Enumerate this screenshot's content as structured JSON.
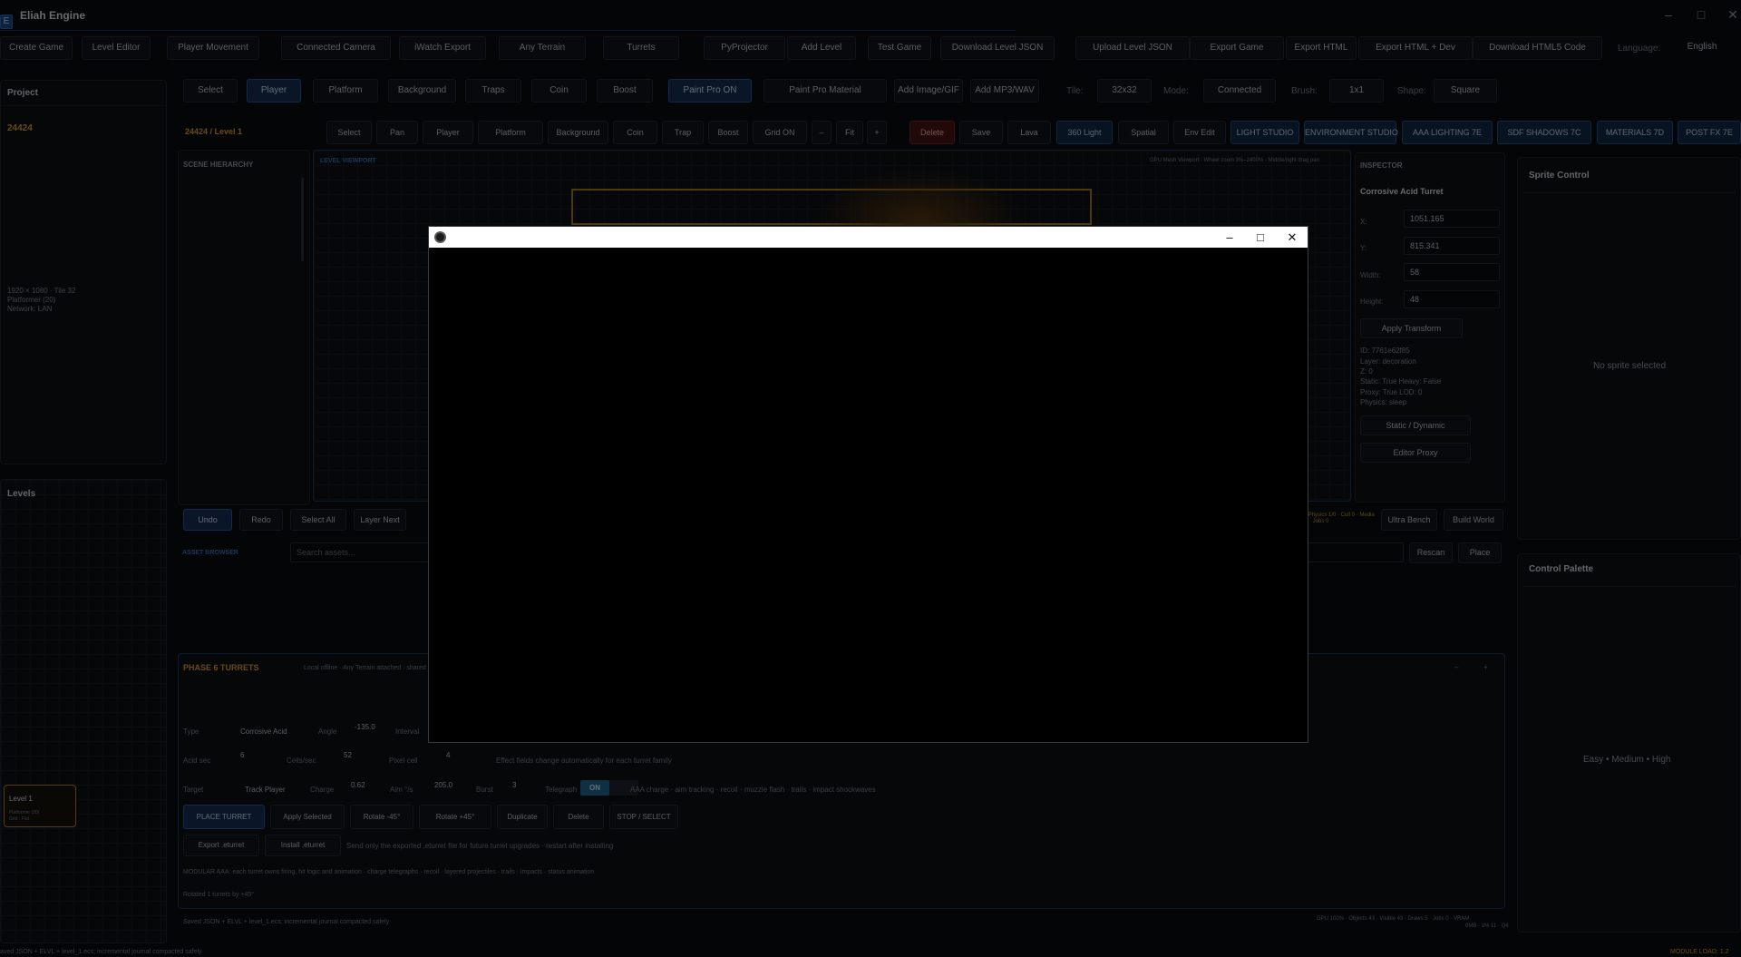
{
  "app": {
    "title": "Eliah Engine",
    "icon_letter": "E"
  },
  "window_controls": {
    "minimize": "–",
    "maximize": "□",
    "close": "✕"
  },
  "main_menu": [
    "Create Game",
    "Level Editor",
    "Player Movement",
    "Connected Camera",
    "iWatch Export",
    "Any Terrain",
    "Turrets",
    "PyProjector",
    "Add Level",
    "Test Game",
    "Download Level JSON",
    "Upload Level JSON",
    "Export Game",
    "Export HTML",
    "Export HTML + Dev",
    "Download HTML5 Code"
  ],
  "language": {
    "label": "Language:",
    "value": "English"
  },
  "paint_bar": {
    "buttons": [
      "Select",
      "Player",
      "Platform",
      "Background",
      "Traps",
      "Coin",
      "Boost",
      "Paint Pro ON",
      "Paint Pro Material",
      "Add Image/GIF",
      "Add MP3/WAV"
    ],
    "tile_label": "Tile:",
    "tile_value": "32x32",
    "mode_label": "Mode:",
    "mode_value": "Connected",
    "brush_label": "Brush:",
    "brush_value": "1x1",
    "shape_label": "Shape:",
    "shape_value": "Square"
  },
  "project": {
    "title": "Project",
    "name": "24424",
    "info": [
      "1920 × 1080 · Tile 32",
      "Platformer (20)",
      "Network: LAN"
    ]
  },
  "levels": {
    "title": "Levels",
    "card": {
      "name": "Level 1",
      "line1": "Platformer (20)",
      "line2": "Grid · Flat"
    }
  },
  "tool_bar": {
    "breadcrumb": "24424 / Level 1",
    "buttons": [
      "Select",
      "Pan",
      "Player",
      "Platform",
      "Background",
      "Coin",
      "Trap",
      "Boost",
      "Grid ON",
      "–",
      "Fit",
      "+",
      "Delete",
      "Save",
      "Lava",
      "360 Light",
      "Spatial",
      "Env Edit",
      "LIGHT STUDIO",
      "ENVIRONMENT STUDIO",
      "AAA LIGHTING 7E",
      "SDF SHADOWS 7C",
      "MATERIALS 7D",
      "POST FX 7E"
    ]
  },
  "scene_hierarchy": {
    "title": "SCENE HIERARCHY"
  },
  "viewport": {
    "title": "LEVEL VIEWPORT",
    "hint": "GPU Mesh Viewport · Wheel zoom 3%–2400% · Middle/right drag pan"
  },
  "inspector": {
    "title": "INSPECTOR",
    "object": "Corrosive Acid Turret",
    "x_label": "X:",
    "x": "1051.165",
    "y_label": "Y:",
    "y": "815.341",
    "w_label": "Width:",
    "w": "58",
    "h_label": "Height:",
    "h": "48",
    "apply": "Apply Transform",
    "meta": [
      "ID: 7761e62f85",
      "Layer: decoration",
      "Z: 0",
      "Static: True  Heavy: False",
      "Proxy: True  LOD: 0",
      "Physics: sleep"
    ],
    "static_btn": "Static / Dynamic",
    "proxy_btn": "Editor Proxy"
  },
  "sprite_control": {
    "title": "Sprite Control",
    "empty": "No sprite selected"
  },
  "control_palette": {
    "title": "Control Palette",
    "levels": "Easy  •  Medium  •  High"
  },
  "edit_bar": {
    "buttons": [
      "Undo",
      "Redo",
      "Select All",
      "Layer Next"
    ],
    "status": "0 · Physics 1/0 · Cull 0 · Media 0/0 · Jobs 0",
    "right_buttons": [
      "Ultra Bench",
      "Build World"
    ]
  },
  "asset_browser": {
    "title": "ASSET BROWSER",
    "placeholder": "Search assets...",
    "rescan": "Rescan",
    "place": "Place"
  },
  "turrets": {
    "title": "PHASE 6 TURRETS",
    "subtitle": "Local offline · Any Terrain attached · shared",
    "collapse": "–",
    "expand": "+",
    "row1": {
      "type_label": "Type",
      "type": "Corrosive Acid",
      "angle_label": "Angle",
      "angle": "-135.0",
      "interval_label": "Interval"
    },
    "row2": {
      "acid_label": "Acid sec",
      "acid": "6",
      "cells_label": "Cells/sec",
      "cells": "52",
      "pixel_label": "Pixel cell",
      "pixel": "4",
      "note": "Effect fields change automatically for each turret family"
    },
    "row3": {
      "target_label": "Target",
      "target": "Track Player",
      "charge_label": "Charge",
      "charge": "0.62",
      "aim_label": "Aim °/s",
      "aim": "205.0",
      "burst_label": "Burst",
      "burst": "3",
      "telegraph_label": "Telegraph",
      "telegraph": "ON",
      "note": "AAA charge · aim tracking · recoil · muzzle flash · trails · impact shockwaves"
    },
    "actions": [
      "PLACE TURRET",
      "Apply Selected",
      "Rotate -45°",
      "Rotate +45°",
      "Duplicate",
      "Delete",
      "STOP / SELECT"
    ],
    "export": "Export .eturret",
    "install": "Install .eturret",
    "export_note": "Send only the exported .eturret file for future turret upgrades · restart after installing",
    "modular_note": "MODULAR AAA: each turret owns firing, hit logic and animation · charge telegraphs · recoil · layered projectiles · trails · impacts · status animation",
    "rotated_note": "Rotated 1 turrets by +45°"
  },
  "status": {
    "saved": "Saved JSON + ELVL + level_1.ecs; incremental journal compacted safely",
    "gpu": "GPU 100% · Objects 43 · Visible 43 · Draws 5 · Jobs 0 · VRAM",
    "gpu2": "0MB · 1% 11 · Q4",
    "bottom": "aved JSON + ELVL + level_1.ecs; incremental journal compacted safely",
    "module_load": "MODULE LOAD: 1.2"
  },
  "colors": {
    "accent": "#2c5fa3",
    "orange": "#e7a534",
    "bg": "#0a0c10"
  }
}
